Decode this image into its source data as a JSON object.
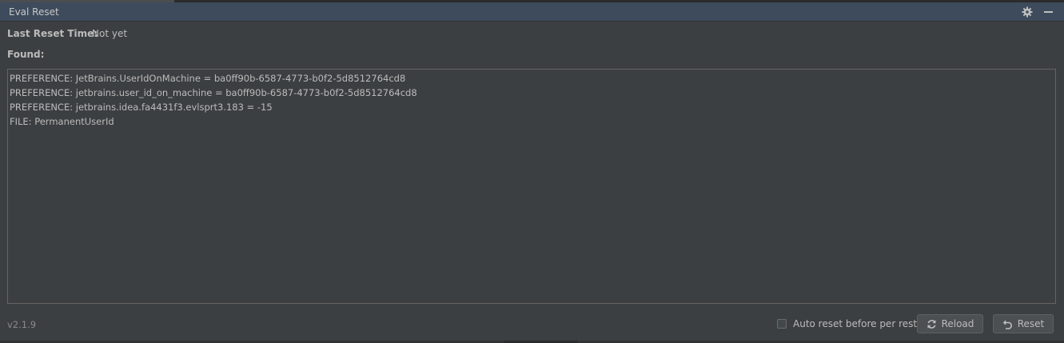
{
  "window": {
    "title": "Eval Reset"
  },
  "icons": {
    "settings": "gear-icon",
    "minimize": "minimize-icon",
    "reload": "reload-icon",
    "reset": "undo-icon"
  },
  "info": {
    "last_reset_label": "Last Reset Time:",
    "last_reset_value": "Not yet",
    "found_label": "Found:"
  },
  "found_items": [
    "PREFERENCE: JetBrains.UserIdOnMachine = ba0ff90b-6587-4773-b0f2-5d8512764cd8",
    "PREFERENCE: jetbrains.user_id_on_machine = ba0ff90b-6587-4773-b0f2-5d8512764cd8",
    "PREFERENCE: jetbrains.idea.fa4431f3.evlsprt3.183 = -15",
    "FILE: PermanentUserId"
  ],
  "footer": {
    "version": "v2.1.9",
    "auto_reset_label": "Auto reset before per restart",
    "auto_reset_checked": false,
    "reload_label": "Reload",
    "reset_label": "Reset"
  },
  "colors": {
    "background": "#3c3f41",
    "titlebar": "#3d4b5c",
    "text": "#bbbbbb",
    "border": "#646464"
  }
}
